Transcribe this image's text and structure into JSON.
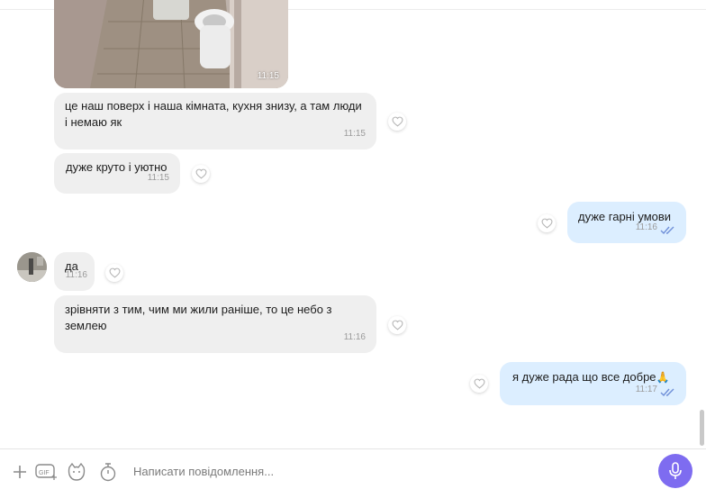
{
  "messages": [
    {
      "id": "photo",
      "direction": "incoming",
      "type": "image",
      "time": "11:15"
    },
    {
      "id": "m1",
      "direction": "incoming",
      "lines": [
        "це наш поверх і наша кімната, кухня знизу, а там люди",
        "і немаю як"
      ],
      "time": "11:15"
    },
    {
      "id": "m2",
      "direction": "incoming",
      "lines": [
        "дуже круто і уютно"
      ],
      "time": "11:15"
    },
    {
      "id": "m3",
      "direction": "outgoing",
      "lines": [
        "дуже гарні умови"
      ],
      "time": "11:16",
      "status": "read"
    },
    {
      "id": "m4",
      "direction": "incoming",
      "lines": [
        "да"
      ],
      "time": "11:16"
    },
    {
      "id": "m5",
      "direction": "incoming",
      "lines": [
        "зрівняти з тим, чим ми жили раніше, то це небо з",
        "землею"
      ],
      "time": "11:16"
    },
    {
      "id": "m6",
      "direction": "outgoing",
      "lines": [
        "я дуже рада що все добре"
      ],
      "emoji": "🙏",
      "time": "11:17",
      "status": "read"
    }
  ],
  "composer": {
    "placeholder": "Написати повідомлення...",
    "icons": [
      "plus-icon",
      "gif-icon",
      "sticker-icon",
      "timer-icon",
      "microphone-icon"
    ]
  },
  "colors": {
    "incoming_bubble": "#efefef",
    "outgoing_bubble": "#dceeff",
    "accent": "#7e6cf0",
    "read_ticks": "#6f8fd8"
  }
}
